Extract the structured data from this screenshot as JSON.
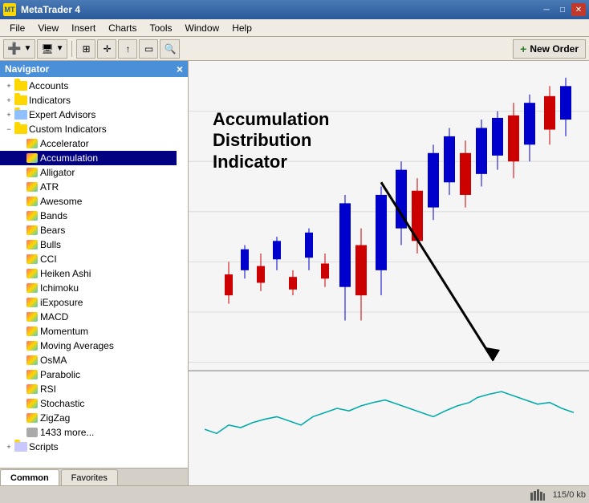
{
  "title_bar": {
    "title": "MetaTrader 4",
    "icon": "MT",
    "btn_minimize": "─",
    "btn_maximize": "□",
    "btn_close": "✕"
  },
  "menu": {
    "items": [
      "File",
      "View",
      "Insert",
      "Charts",
      "Tools",
      "Window",
      "Help"
    ]
  },
  "toolbar": {
    "new_order": "New Order"
  },
  "navigator": {
    "title": "Navigator",
    "close": "×",
    "sections": [
      {
        "id": "accounts",
        "label": "Accounts",
        "icon": "folder",
        "level": 0,
        "expanded": false
      },
      {
        "id": "indicators",
        "label": "Indicators",
        "icon": "folder",
        "level": 0,
        "expanded": false
      },
      {
        "id": "expert_advisors",
        "label": "Expert Advisors",
        "icon": "folder",
        "level": 0,
        "expanded": false
      },
      {
        "id": "custom_indicators",
        "label": "Custom Indicators",
        "icon": "folder",
        "level": 0,
        "expanded": true
      }
    ],
    "indicators": [
      {
        "id": "accelerator",
        "label": "Accelerator",
        "icon": "indicator",
        "level": 1
      },
      {
        "id": "accumulation",
        "label": "Accumulation",
        "icon": "indicator",
        "level": 1,
        "selected": true
      },
      {
        "id": "alligator",
        "label": "Alligator",
        "icon": "indicator",
        "level": 1
      },
      {
        "id": "atr",
        "label": "ATR",
        "icon": "indicator",
        "level": 1
      },
      {
        "id": "awesome",
        "label": "Awesome",
        "icon": "indicator",
        "level": 1
      },
      {
        "id": "bands",
        "label": "Bands",
        "icon": "indicator",
        "level": 1
      },
      {
        "id": "bears",
        "label": "Bears",
        "icon": "indicator",
        "level": 1
      },
      {
        "id": "bulls",
        "label": "Bulls",
        "icon": "indicator",
        "level": 1
      },
      {
        "id": "cci",
        "label": "CCI",
        "icon": "indicator",
        "level": 1
      },
      {
        "id": "heiken_ashi",
        "label": "Heiken Ashi",
        "icon": "indicator",
        "level": 1
      },
      {
        "id": "ichimoku",
        "label": "Ichimoku",
        "icon": "indicator",
        "level": 1
      },
      {
        "id": "iexposure",
        "label": "iExposure",
        "icon": "indicator",
        "level": 1
      },
      {
        "id": "macd",
        "label": "MACD",
        "icon": "indicator",
        "level": 1
      },
      {
        "id": "momentum",
        "label": "Momentum",
        "icon": "indicator",
        "level": 1
      },
      {
        "id": "moving_averages",
        "label": "Moving Averages",
        "icon": "indicator",
        "level": 1
      },
      {
        "id": "osma",
        "label": "OsMA",
        "icon": "indicator",
        "level": 1
      },
      {
        "id": "parabolic",
        "label": "Parabolic",
        "icon": "indicator",
        "level": 1
      },
      {
        "id": "rsi",
        "label": "RSI",
        "icon": "indicator",
        "level": 1
      },
      {
        "id": "stochastic",
        "label": "Stochastic",
        "icon": "indicator",
        "level": 1
      },
      {
        "id": "zigzag",
        "label": "ZigZag",
        "icon": "indicator",
        "level": 1
      },
      {
        "id": "more",
        "label": "1433 more...",
        "icon": "indicator",
        "level": 1
      }
    ],
    "scripts": [
      {
        "id": "scripts",
        "label": "Scripts",
        "icon": "folder",
        "level": 0
      }
    ],
    "tabs": [
      {
        "id": "common",
        "label": "Common",
        "active": true
      },
      {
        "id": "favorites",
        "label": "Favorites",
        "active": false
      }
    ]
  },
  "annotation": {
    "line1": "Accumulation",
    "line2": "Distribution",
    "line3": "Indicator"
  },
  "status_bar": {
    "chart_bars": "115/0 kb"
  }
}
